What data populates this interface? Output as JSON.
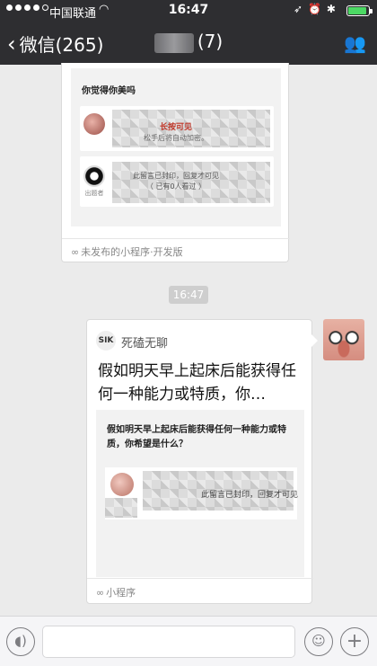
{
  "status_bar": {
    "carrier": "中国联通",
    "time": "16:47",
    "battery_level": 0.8,
    "signal_bars": 4
  },
  "nav": {
    "back_label": "微信(265)",
    "chat_title": "(7)"
  },
  "card1": {
    "question": "你觉得你美吗",
    "red_text": "长按可见",
    "faint_text_1": "松手后将自动加密。",
    "faint_text_2": "此留言已封印，回复才可见",
    "faint_text_3": "（ 已有0人看过 ）",
    "sublabel": "出题者",
    "footer": "未发布的小程序·开发版"
  },
  "timestamp": "16:47",
  "card2": {
    "app_logo": "SIK",
    "app_name": "死磕无聊",
    "title": "假如明天早上起床后能获得任何一种能力或特质，你…",
    "preview_question": "假如明天早上起床后能获得任何一种能力或特质，你希望是什么？",
    "preview_note": "此留言已封印，回复才可见",
    "footer": "小程序"
  },
  "icons": {
    "battery": "battery-icon",
    "wifi": "wifi-icon",
    "back": "chevron-left-icon",
    "people": "people-icon",
    "voice": "voice-icon",
    "emoji": "emoji-icon",
    "plus": "plus-icon"
  },
  "colors": {
    "nav_bg": "#2e2e31",
    "chat_bg": "#ebebeb",
    "battery_green": "#4cd964",
    "accent_red": "#c0392b"
  }
}
